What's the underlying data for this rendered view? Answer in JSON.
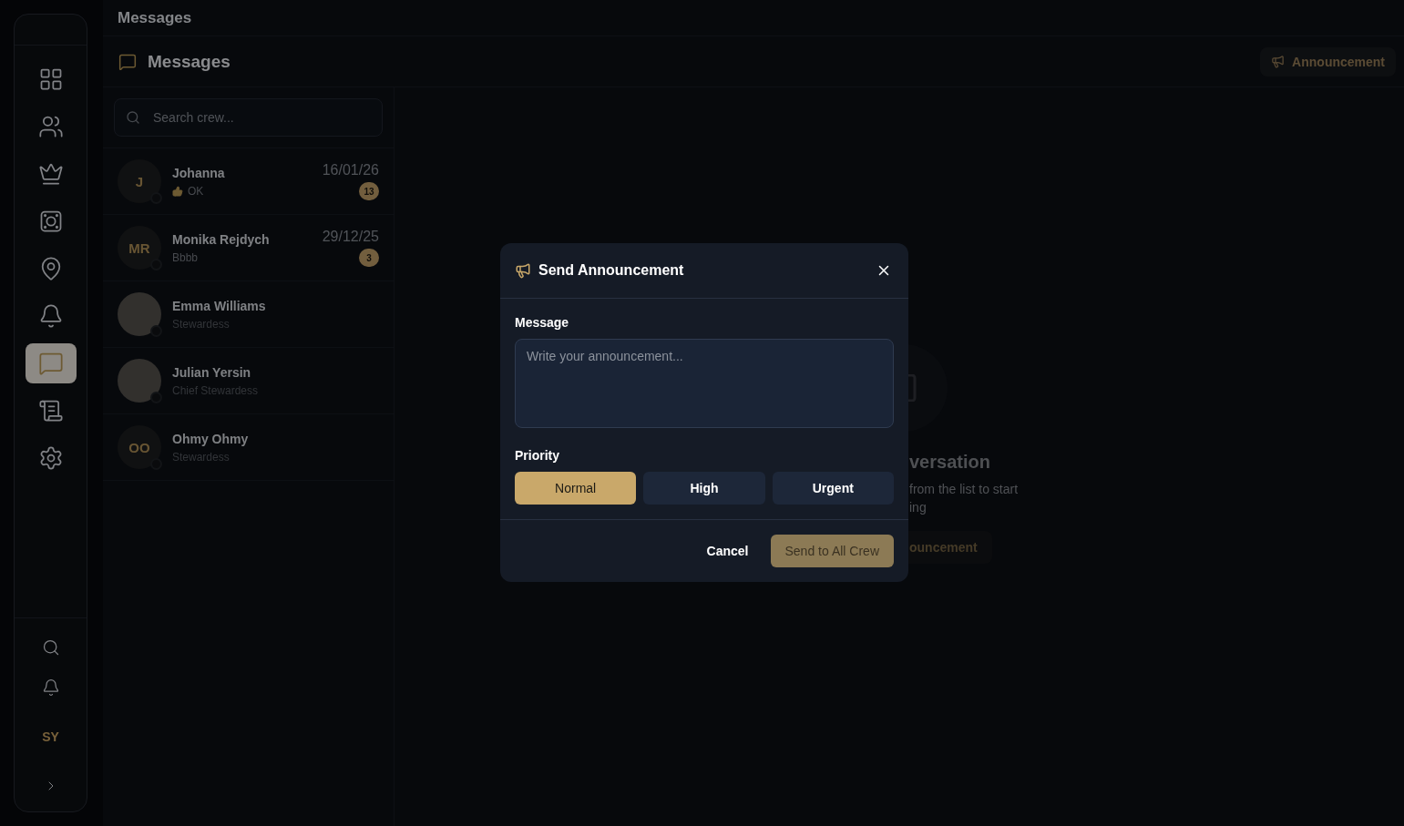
{
  "top_bar": {
    "title": "Messages"
  },
  "nav": {
    "items": [
      {
        "selected": false
      },
      {
        "selected": false
      },
      {
        "selected": false
      },
      {
        "selected": false
      },
      {
        "selected": false
      },
      {
        "selected": false
      },
      {
        "selected": true
      },
      {
        "selected": false
      },
      {
        "selected": false
      }
    ],
    "user_initials": "SY"
  },
  "header": {
    "title": "Messages",
    "announcement_button": "Announcement"
  },
  "search": {
    "placeholder": "Search crew..."
  },
  "conversations": [
    {
      "kind": "initials",
      "initials": "J",
      "name": "Johanna",
      "preview": "OK",
      "thumbs_up": true,
      "date": "16/01/26",
      "unread": "13"
    },
    {
      "kind": "initials",
      "initials": "MR",
      "name": "Monika Rejdych",
      "preview": "Bbbb",
      "thumbs_up": false,
      "date": "29/12/25",
      "unread": "3"
    },
    {
      "kind": "photo",
      "name": "Emma Williams",
      "role": "Stewardess"
    },
    {
      "kind": "photo",
      "name": "Julian Yersin",
      "role": "Chief Stewardess"
    },
    {
      "kind": "initials",
      "initials": "OO",
      "name": "Ohmy Ohmy",
      "role": "Stewardess"
    }
  ],
  "empty_state": {
    "title": "versation",
    "lines": [
      "from the list to start",
      "ing"
    ],
    "button": "ouncement"
  },
  "dialog": {
    "title": "Send Announcement",
    "message_label": "Message",
    "placeholder": "Write your announcement...",
    "priority_label": "Priority",
    "priorities": [
      {
        "label": "Normal",
        "selected": true
      },
      {
        "label": "High",
        "selected": false
      },
      {
        "label": "Urgent",
        "selected": false
      }
    ],
    "cancel": "Cancel",
    "submit": "Send to All Crew"
  }
}
